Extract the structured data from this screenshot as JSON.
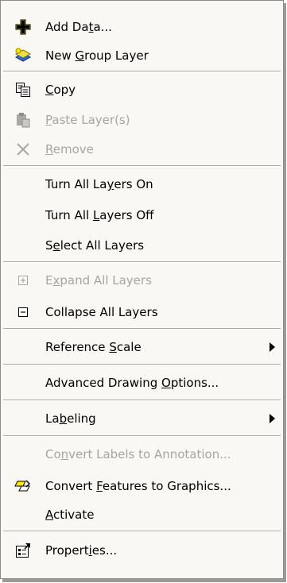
{
  "menu": {
    "items": [
      {
        "label_pre": "Add Da",
        "label_u": "t",
        "label_post": "a...",
        "icon": "add-data-icon",
        "enabled": true
      },
      {
        "label_pre": "New ",
        "label_u": "G",
        "label_post": "roup Layer",
        "icon": "new-group-layer-icon",
        "enabled": true
      },
      {
        "label_pre": "",
        "label_u": "C",
        "label_post": "opy",
        "icon": "copy-icon",
        "enabled": true
      },
      {
        "label_pre": "",
        "label_u": "P",
        "label_post": "aste Layer(s)",
        "icon": "paste-icon",
        "enabled": false
      },
      {
        "label_pre": "",
        "label_u": "R",
        "label_post": "emove",
        "icon": "remove-icon",
        "enabled": false
      },
      {
        "label_pre": "Turn All La",
        "label_u": "y",
        "label_post": "ers On",
        "enabled": true
      },
      {
        "label_pre": "Turn All ",
        "label_u": "L",
        "label_post": "ayers Off",
        "enabled": true
      },
      {
        "label_pre": "S",
        "label_u": "e",
        "label_post": "lect All Layers",
        "enabled": true
      },
      {
        "label_pre": "E",
        "label_u": "x",
        "label_post": "pand All Layers",
        "icon": "expand-icon",
        "enabled": false
      },
      {
        "label_pre": "Collapse All Layers",
        "label_u": "",
        "label_post": "",
        "icon": "collapse-icon",
        "enabled": true
      },
      {
        "label_pre": "Reference ",
        "label_u": "S",
        "label_post": "cale",
        "enabled": true,
        "submenu": true
      },
      {
        "label_pre": "Advanced Drawing ",
        "label_u": "O",
        "label_post": "ptions...",
        "enabled": true
      },
      {
        "label_pre": "La",
        "label_u": "b",
        "label_post": "eling",
        "enabled": true,
        "submenu": true
      },
      {
        "label_pre": "Co",
        "label_u": "n",
        "label_post": "vert Labels to Annotation...",
        "enabled": false
      },
      {
        "label_pre": "Convert ",
        "label_u": "F",
        "label_post": "eatures to Graphics...",
        "icon": "convert-features-icon",
        "enabled": true
      },
      {
        "label_pre": "",
        "label_u": "A",
        "label_post": "ctivate",
        "enabled": true
      },
      {
        "label_pre": "Propert",
        "label_u": "i",
        "label_post": "es...",
        "icon": "properties-icon",
        "enabled": true
      }
    ]
  }
}
